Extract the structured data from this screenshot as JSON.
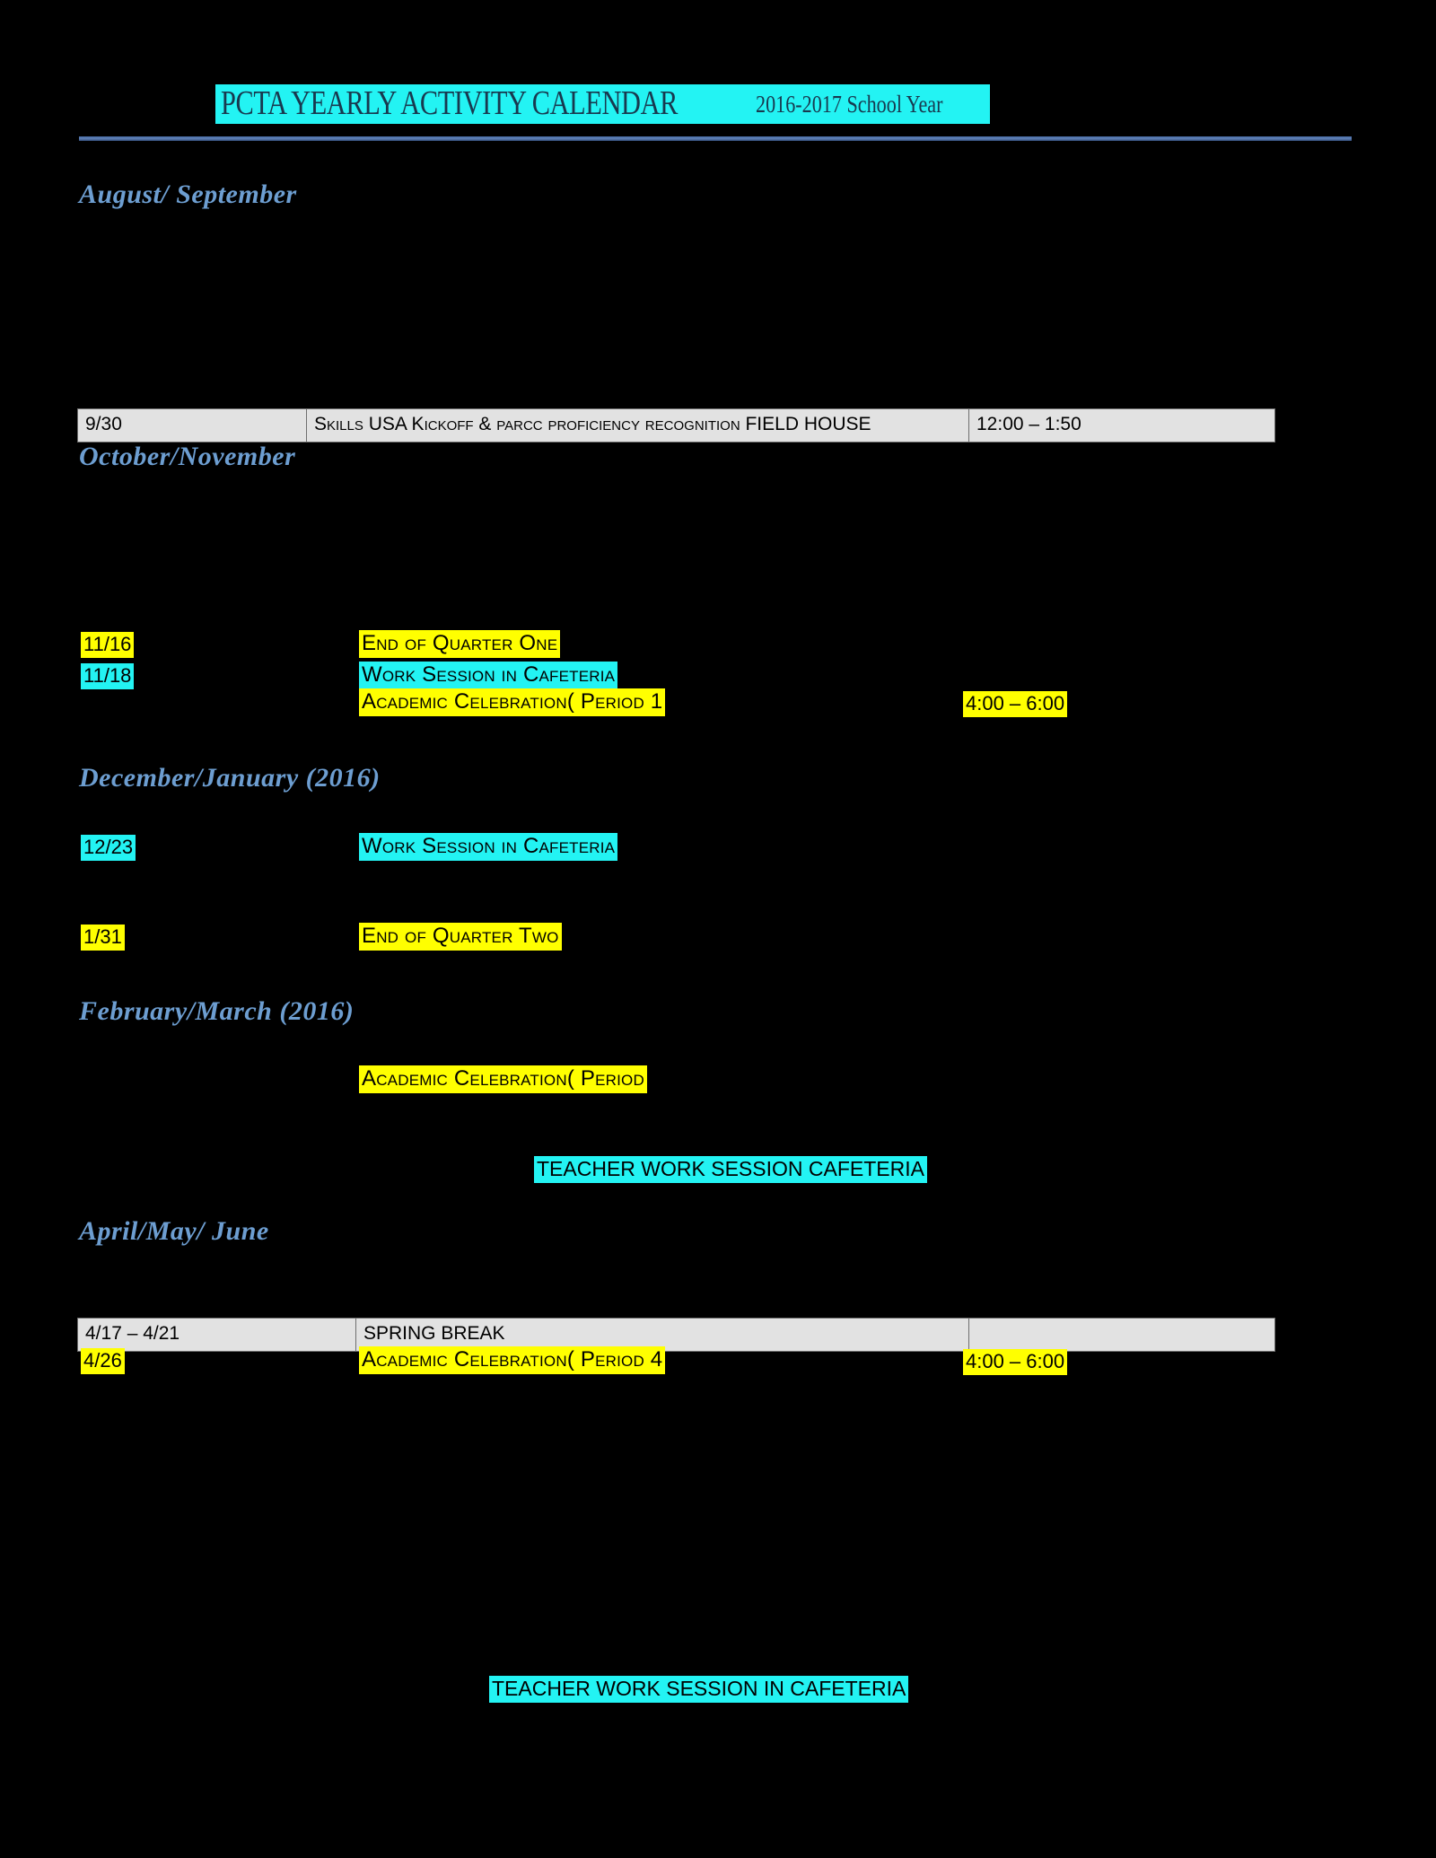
{
  "document": {
    "title_main": "PCTA YEARLY ACTIVITY CALENDAR",
    "title_sub": "2016-2017 School Year"
  },
  "colors": {
    "page_background": "#000000",
    "highlight_yellow": "#ffff00",
    "highlight_cyan": "#23f3f3",
    "heading_blue": "#6d9ed1",
    "title_text": "#18394f",
    "table_background": "#e2e2e2",
    "table_border": "#6f6f6f",
    "rule": "#4a6fa8"
  },
  "sections": [
    {
      "id": "august-september",
      "heading": "August/ September",
      "table_rows": [
        {
          "date": "9/30",
          "event": "Skills USA Kickoff & parcc proficiency recognition FIELD HOUSE",
          "time": "12:00 – 1:50"
        }
      ],
      "entries": []
    },
    {
      "id": "october-november",
      "heading": "October/November",
      "table_rows": [],
      "entries": [
        {
          "date": "11/16",
          "date_highlight": "yellow",
          "event": "End of Quarter One",
          "event_highlight": "yellow",
          "time": "",
          "time_highlight": ""
        },
        {
          "date": "11/18",
          "date_highlight": "cyan",
          "event": "Work Session in Cafeteria",
          "event_highlight": "cyan",
          "time": "",
          "time_highlight": ""
        },
        {
          "date": "",
          "date_highlight": "",
          "event": "Academic Celebration( Period 1",
          "event_highlight": "yellow",
          "time": "4:00 – 6:00",
          "time_highlight": "yellow"
        }
      ]
    },
    {
      "id": "december-january",
      "heading": "December/January (2016)",
      "table_rows": [],
      "entries": [
        {
          "date": "12/23",
          "date_highlight": "cyan",
          "event": "Work Session in Cafeteria",
          "event_highlight": "cyan",
          "time": "",
          "time_highlight": ""
        },
        {
          "date": "1/31",
          "date_highlight": "yellow",
          "event": "End of Quarter Two",
          "event_highlight": "yellow",
          "time": "",
          "time_highlight": ""
        }
      ]
    },
    {
      "id": "february-march",
      "heading": "February/March (2016)",
      "table_rows": [],
      "entries": [
        {
          "date": "",
          "date_highlight": "",
          "event": "Academic Celebration( Period",
          "event_highlight": "yellow",
          "time": "",
          "time_highlight": ""
        },
        {
          "date": "",
          "date_highlight": "",
          "event": "TEACHER WORK SESSION CAFETERIA",
          "event_highlight": "cyan",
          "time": "",
          "time_highlight": ""
        }
      ]
    },
    {
      "id": "april-may-june",
      "heading": "April/May/ June",
      "table_rows": [
        {
          "date": "4/17 – 4/21",
          "event": "SPRING BREAK",
          "time": ""
        }
      ],
      "entries": [
        {
          "date": "4/26",
          "date_highlight": "yellow",
          "event": "Academic Celebration( Period 4",
          "event_highlight": "yellow",
          "time": "4:00 – 6:00",
          "time_highlight": "yellow"
        },
        {
          "date": "",
          "date_highlight": "",
          "event": "TEACHER WORK SESSION IN CAFETERIA",
          "event_highlight": "cyan",
          "time": "",
          "time_highlight": ""
        }
      ]
    }
  ]
}
